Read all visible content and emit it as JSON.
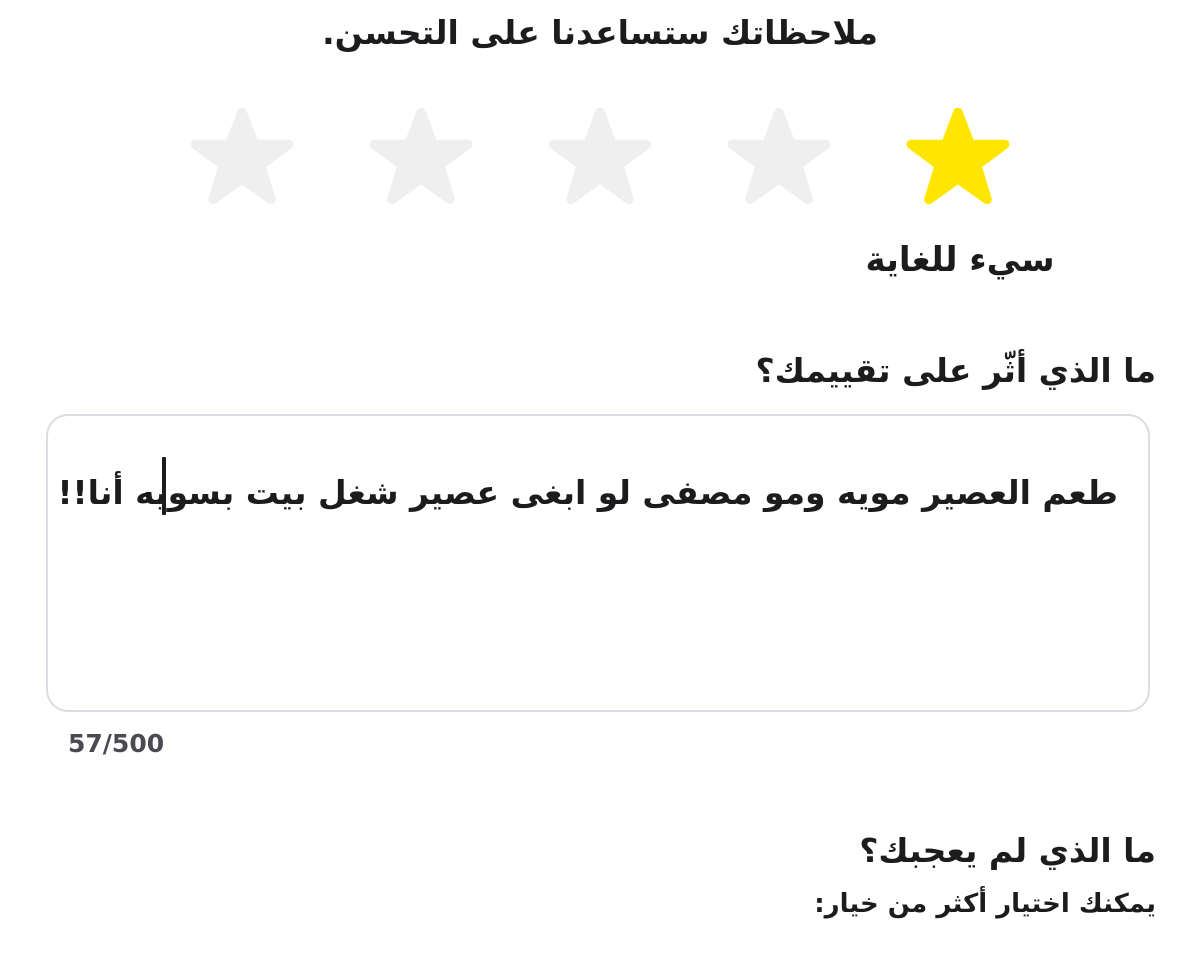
{
  "header": {
    "title": "ملاحظاتك ستساعدنا على التحسن."
  },
  "rating": {
    "value": 1,
    "max": 5,
    "label": "سيء للغاية",
    "filled_color": "#FFE600",
    "empty_color": "#EFEFEF",
    "stars": [
      {
        "icon": "star-icon",
        "filled": true
      },
      {
        "icon": "star-icon",
        "filled": false
      },
      {
        "icon": "star-icon",
        "filled": false
      },
      {
        "icon": "star-icon",
        "filled": false
      },
      {
        "icon": "star-icon",
        "filled": false
      }
    ]
  },
  "feedback": {
    "question": "ما الذي أثّر على تقييمك؟",
    "value": "طعم العصير مويه ومو مصفى لو ابغى عصير شغل بيت بسويه أنا!!",
    "counter": "57/500",
    "border_color": "#DCDCE2"
  },
  "dislikes": {
    "question": "ما الذي لم يعجبك؟",
    "hint": "يمكنك اختيار أكثر من خيار:"
  }
}
